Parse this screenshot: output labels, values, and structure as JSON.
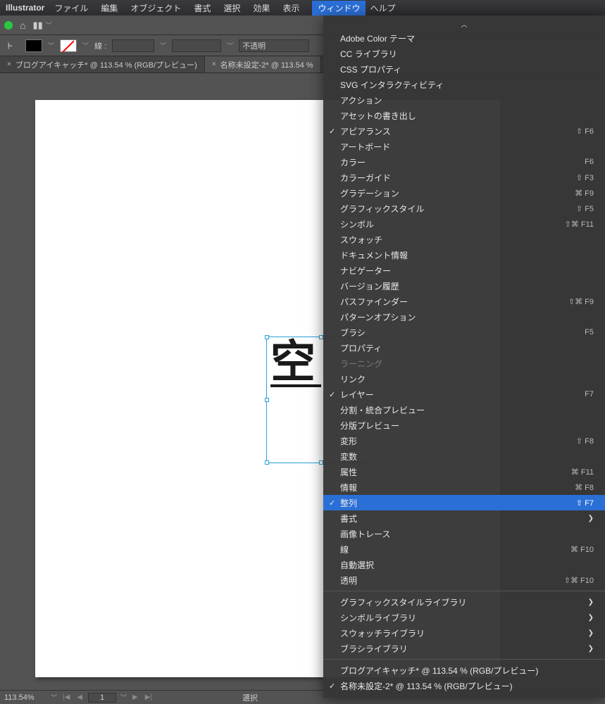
{
  "menubar": {
    "app": "Illustrator",
    "items": [
      "ファイル",
      "編集",
      "オブジェクト",
      "書式",
      "選択",
      "効果",
      "表示",
      "ウィンドウ",
      "ヘルプ"
    ],
    "active_index": 7
  },
  "controlbar": {
    "object_label": "ト",
    "stroke_label": "線 :",
    "opacity_label": "不透明"
  },
  "tabs": [
    {
      "label": "ブログアイキャッチ* @ 113.54 % (RGB/プレビュー)",
      "active": false
    },
    {
      "label": "名称未設定-2* @ 113.54 %",
      "active": true
    }
  ],
  "canvas": {
    "text": "空"
  },
  "dropdown": {
    "items": [
      {
        "label": "Adobe Color テーマ"
      },
      {
        "label": "CC ライブラリ"
      },
      {
        "label": "CSS プロパティ"
      },
      {
        "label": "SVG インタラクティビティ"
      },
      {
        "label": "アクション"
      },
      {
        "label": "アセットの書き出し"
      },
      {
        "label": "アピアランス",
        "checked": true,
        "shortcut": "⇧ F6"
      },
      {
        "label": "アートボード"
      },
      {
        "label": "カラー",
        "shortcut": "F6"
      },
      {
        "label": "カラーガイド",
        "shortcut": "⇧ F3"
      },
      {
        "label": "グラデーション",
        "shortcut": "⌘ F9"
      },
      {
        "label": "グラフィックスタイル",
        "shortcut": "⇧ F5"
      },
      {
        "label": "シンボル",
        "shortcut": "⇧⌘ F11"
      },
      {
        "label": "スウォッチ"
      },
      {
        "label": "ドキュメント情報"
      },
      {
        "label": "ナビゲーター"
      },
      {
        "label": "バージョン履歴"
      },
      {
        "label": "パスファインダー",
        "shortcut": "⇧⌘ F9"
      },
      {
        "label": "パターンオプション"
      },
      {
        "label": "ブラシ",
        "shortcut": "F5"
      },
      {
        "label": "プロパティ"
      },
      {
        "label": "ラーニング",
        "disabled": true
      },
      {
        "label": "リンク"
      },
      {
        "label": "レイヤー",
        "checked": true,
        "shortcut": "F7"
      },
      {
        "label": "分割・統合プレビュー"
      },
      {
        "label": "分版プレビュー"
      },
      {
        "label": "変形",
        "shortcut": "⇧ F8"
      },
      {
        "label": "変数"
      },
      {
        "label": "属性",
        "shortcut": "⌘ F11"
      },
      {
        "label": "情報",
        "shortcut": "⌘ F8"
      },
      {
        "label": "整列",
        "checked": true,
        "shortcut": "⇧ F7",
        "highlighted": true
      },
      {
        "label": "書式",
        "submenu": true
      },
      {
        "label": "画像トレース"
      },
      {
        "label": "線",
        "shortcut": "⌘ F10"
      },
      {
        "label": "自動選択"
      },
      {
        "label": "透明",
        "shortcut": "⇧⌘ F10"
      },
      {
        "sep": true
      },
      {
        "label": "グラフィックスタイルライブラリ",
        "submenu": true
      },
      {
        "label": "シンボルライブラリ",
        "submenu": true
      },
      {
        "label": "スウォッチライブラリ",
        "submenu": true
      },
      {
        "label": "ブラシライブラリ",
        "submenu": true
      },
      {
        "sep": true
      },
      {
        "label": "ブログアイキャッチ* @ 113.54 % (RGB/プレビュー)"
      },
      {
        "label": "名称未設定-2* @ 113.54 % (RGB/プレビュー)",
        "checked": true
      }
    ]
  },
  "statusbar": {
    "zoom": "113.54%",
    "page": "1",
    "selection": "選択"
  }
}
